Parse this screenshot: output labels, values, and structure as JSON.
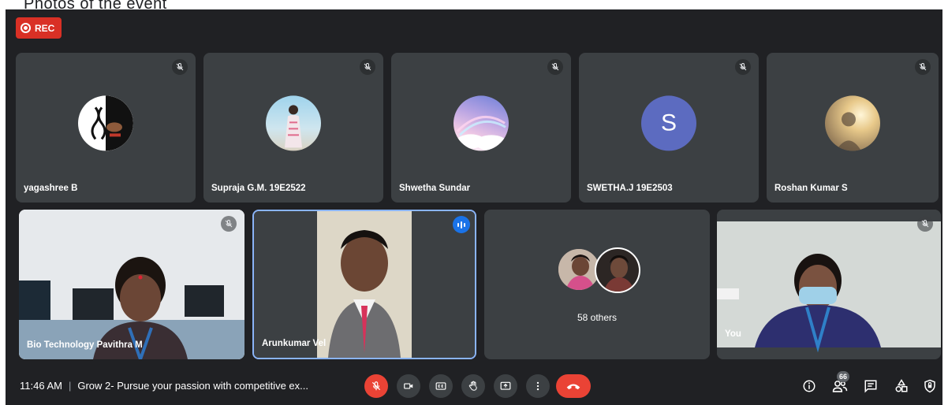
{
  "caption": "Photos of the event",
  "recording": {
    "label": "REC"
  },
  "participants_top": [
    {
      "name": "yagashree B",
      "muted": true,
      "avatar": "logo-avatar"
    },
    {
      "name": "Supraja G.M. 19E2522",
      "muted": true,
      "avatar": "photo-avatar"
    },
    {
      "name": "Shwetha Sundar",
      "muted": true,
      "avatar": "sky-avatar"
    },
    {
      "name": "SWETHA.J 19E2503",
      "muted": true,
      "avatar": "letter-avatar",
      "letter": "S"
    },
    {
      "name": "Roshan Kumar S",
      "muted": true,
      "avatar": "photo-avatar"
    }
  ],
  "participants_bottom": [
    {
      "name": "Bio Technology Pavithra M",
      "muted": true
    },
    {
      "name": "Arunkumar Vel",
      "speaking": true
    },
    {
      "others_label": "58 others"
    },
    {
      "name": "You",
      "muted": true
    }
  ],
  "bottom_bar": {
    "time": "11:46 AM",
    "separator": "|",
    "meeting_title": "Grow 2- Pursue your passion with competitive ex...",
    "participant_count": "66"
  },
  "colors": {
    "stage": "#202124",
    "tile": "#3c4043",
    "danger": "#ea4335",
    "speaking_border": "#8ab4f8",
    "letter_avatar": "#5c6bc0"
  }
}
